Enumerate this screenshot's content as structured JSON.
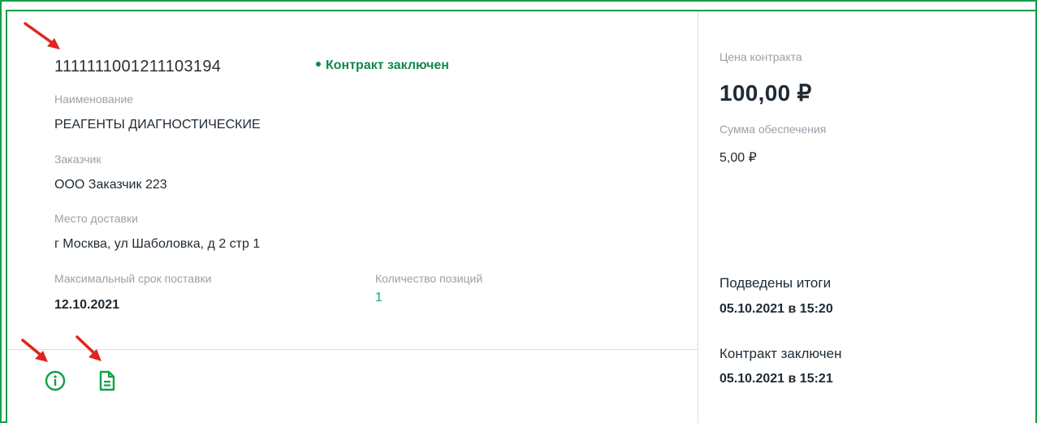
{
  "contract": {
    "number": "1111111001211103194",
    "status": "Контракт заключен",
    "name_label": "Наименование",
    "name_value": "РЕАГЕНТЫ ДИАГНОСТИЧЕСКИЕ",
    "customer_label": "Заказчик",
    "customer_value": "ООО Заказчик 223",
    "delivery_place_label": "Место доставки",
    "delivery_place_value": "г Москва, ул Шаболовка, д 2 стр 1",
    "max_delivery_label": "Максимальный срок поставки",
    "max_delivery_value": "12.10.2021",
    "positions_label": "Количество позиций",
    "positions_value": "1"
  },
  "right_panel": {
    "price_label": "Цена контракта",
    "price_value": "100,00 ₽",
    "security_label": "Сумма обеспечения",
    "security_value": "5,00 ₽",
    "results_label": "Подведены итоги",
    "results_value": "05.10.2021 в 15:20",
    "concluded_label": "Контракт заключен",
    "concluded_value": "05.10.2021 в 15:21"
  },
  "icons": {
    "info": "info-icon",
    "document": "document-icon",
    "annotation_arrow": "red-arrow-icon"
  },
  "colors": {
    "frame_green": "#13a048",
    "status_green": "#13884a",
    "link_green": "#1aa56e",
    "arrow_red": "#e0241c"
  }
}
